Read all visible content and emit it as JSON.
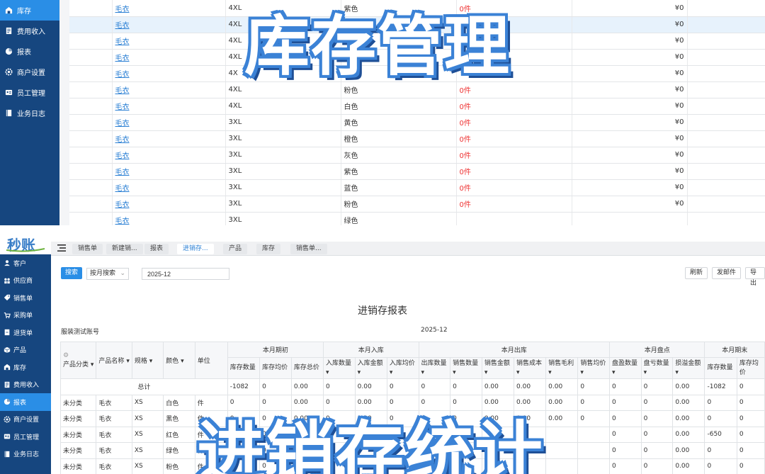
{
  "overlay": {
    "top_title": "库存管理",
    "bottom_title": "进销存统计"
  },
  "top_sidebar": {
    "items": [
      {
        "label": "库存",
        "icon": "warehouse-icon",
        "active": true
      },
      {
        "label": "费用收入",
        "icon": "ledger-icon",
        "active": false
      },
      {
        "label": "报表",
        "icon": "pie-chart-icon",
        "active": false
      },
      {
        "label": "商户设置",
        "icon": "gear-icon",
        "active": false
      },
      {
        "label": "员工管理",
        "icon": "id-card-icon",
        "active": false
      },
      {
        "label": "业务日志",
        "icon": "book-icon",
        "active": false
      }
    ]
  },
  "top_table": {
    "rows": [
      {
        "name": "毛衣",
        "size": "4XL",
        "color": "紫色",
        "stock": "0件",
        "price": "¥0",
        "hl": false
      },
      {
        "name": "毛衣",
        "size": "4XL",
        "color": "",
        "stock": "",
        "price": "¥0",
        "hl": true
      },
      {
        "name": "毛衣",
        "size": "4XL",
        "color": "",
        "stock": "",
        "price": "¥0",
        "hl": false
      },
      {
        "name": "毛衣",
        "size": "4XL",
        "color": "",
        "stock": "",
        "price": "¥0",
        "hl": false
      },
      {
        "name": "毛衣",
        "size": "4X",
        "color": "",
        "stock": "",
        "price": "¥0",
        "hl": false
      },
      {
        "name": "毛衣",
        "size": "4XL",
        "color": "粉色",
        "stock": "0件",
        "price": "¥0",
        "hl": false
      },
      {
        "name": "毛衣",
        "size": "4XL",
        "color": "白色",
        "stock": "0件",
        "price": "¥0",
        "hl": false
      },
      {
        "name": "毛衣",
        "size": "3XL",
        "color": "黄色",
        "stock": "0件",
        "price": "¥0",
        "hl": false
      },
      {
        "name": "毛衣",
        "size": "3XL",
        "color": "橙色",
        "stock": "0件",
        "price": "¥0",
        "hl": false
      },
      {
        "name": "毛衣",
        "size": "3XL",
        "color": "灰色",
        "stock": "0件",
        "price": "¥0",
        "hl": false
      },
      {
        "name": "毛衣",
        "size": "3XL",
        "color": "紫色",
        "stock": "0件",
        "price": "¥0",
        "hl": false
      },
      {
        "name": "毛衣",
        "size": "3XL",
        "color": "蓝色",
        "stock": "0件",
        "price": "¥0",
        "hl": false
      },
      {
        "name": "毛衣",
        "size": "3XL",
        "color": "粉色",
        "stock": "0件",
        "price": "¥0",
        "hl": false
      },
      {
        "name": "毛衣",
        "size": "3XL",
        "color": "绿色",
        "stock": "",
        "price": "",
        "hl": false
      }
    ]
  },
  "brand": {
    "logo_text": "秒账"
  },
  "bottom_sidebar": {
    "items": [
      {
        "label": "客户",
        "icon": "user-icon",
        "active": false
      },
      {
        "label": "供应商",
        "icon": "supplier-icon",
        "active": false
      },
      {
        "label": "销售单",
        "icon": "tag-icon",
        "active": false
      },
      {
        "label": "采购单",
        "icon": "cart-icon",
        "active": false
      },
      {
        "label": "退货单",
        "icon": "return-icon",
        "active": false
      },
      {
        "label": "产品",
        "icon": "box-icon",
        "active": false
      },
      {
        "label": "库存",
        "icon": "warehouse-icon",
        "active": false
      },
      {
        "label": "费用收入",
        "icon": "ledger-icon",
        "active": false
      },
      {
        "label": "报表",
        "icon": "pie-chart-icon",
        "active": true
      },
      {
        "label": "商户设置",
        "icon": "gear-icon",
        "active": false
      },
      {
        "label": "员工管理",
        "icon": "id-card-icon",
        "active": false
      },
      {
        "label": "业务日志",
        "icon": "book-icon",
        "active": false
      }
    ]
  },
  "tabs": [
    {
      "label": "销售单",
      "active": false
    },
    {
      "label": "新建销...",
      "active": false
    },
    {
      "label": "报表",
      "active": false
    },
    {
      "label": "进销存...",
      "active": true
    },
    {
      "label": "产品",
      "active": false
    },
    {
      "label": "库存",
      "active": false
    },
    {
      "label": "销售单...",
      "active": false
    }
  ],
  "toolbar": {
    "search_label": "搜索",
    "mode_value": "按月搜索",
    "month_value": "2025-12",
    "refresh_label": "刷新",
    "send_label": "发邮件",
    "export_label": "导出"
  },
  "report": {
    "title": "进销存报表",
    "company": "服装测试账号",
    "month": "2025-12",
    "fixed_headers": [
      "产品分类",
      "产品名称",
      "规格",
      "颜色",
      "单位"
    ],
    "groups": [
      {
        "label": "本月期初",
        "cols": [
          "库存数量",
          "库存均价",
          "库存总价"
        ]
      },
      {
        "label": "本月入库",
        "cols": [
          "入库数量",
          "入库金额",
          "入库均价"
        ]
      },
      {
        "label": "本月出库",
        "cols": [
          "出库数量",
          "销售数量",
          "销售金额",
          "销售成本",
          "销售毛利",
          "销售均价"
        ]
      },
      {
        "label": "本月盘点",
        "cols": [
          "盘盈数量",
          "盘亏数量",
          "损溢金额"
        ]
      },
      {
        "label": "本月期末",
        "cols": [
          "库存数量",
          "库存均价"
        ]
      }
    ],
    "total_label": "总计",
    "total_values": [
      "-1082",
      "0",
      "0.00",
      "0",
      "0.00",
      "0",
      "0",
      "0",
      "0.00",
      "0.00",
      "0.00",
      "0",
      "0",
      "0",
      "0.00",
      "-1082",
      "0"
    ],
    "rows": [
      {
        "fixed": [
          "未分类",
          "毛衣",
          "XS",
          "白色",
          "件"
        ],
        "values": [
          "0",
          "0",
          "0.00",
          "0",
          "0.00",
          "0",
          "0",
          "0",
          "0.00",
          "0.00",
          "0.00",
          "0",
          "0",
          "0",
          "0.00",
          "0",
          "0"
        ]
      },
      {
        "fixed": [
          "未分类",
          "毛衣",
          "XS",
          "黑色",
          "件"
        ],
        "values": [
          "0",
          "0",
          "0.00",
          "0",
          "0.00",
          "0",
          "0",
          "0",
          "0.00",
          "0.00",
          "0.00",
          "0",
          "0",
          "0",
          "0.00",
          "0",
          "0"
        ]
      },
      {
        "fixed": [
          "未分类",
          "毛衣",
          "XS",
          "红色",
          "件"
        ],
        "values": [
          "-6",
          "0",
          "",
          "",
          "0.00",
          "0",
          "",
          "",
          "",
          "",
          "",
          "",
          "0",
          "0",
          "0.00",
          "-650",
          "0"
        ]
      },
      {
        "fixed": [
          "未分类",
          "毛衣",
          "XS",
          "绿色",
          "件"
        ],
        "values": [
          "0",
          "0",
          "",
          "",
          "",
          "",
          "",
          "",
          "",
          "",
          "",
          "",
          "0",
          "0",
          "0.00",
          "0",
          "0"
        ]
      },
      {
        "fixed": [
          "未分类",
          "毛衣",
          "XS",
          "粉色",
          "件"
        ],
        "values": [
          "0",
          "0",
          "",
          "",
          "",
          "",
          "",
          "",
          "",
          "",
          "",
          "",
          "0",
          "0",
          "0.00",
          "0",
          "0"
        ]
      }
    ]
  },
  "colors": {
    "sidebar": "#16467f",
    "active": "#2a8ee6",
    "accent_title": "#3b82d6",
    "negative": "#e33333"
  }
}
